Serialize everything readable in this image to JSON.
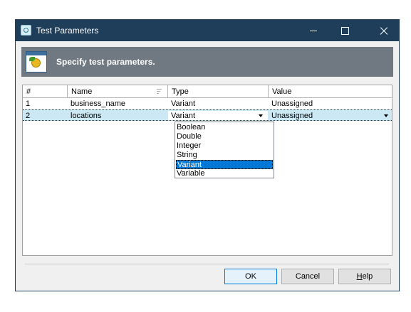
{
  "window": {
    "title": "Test Parameters",
    "icon": "app-icon"
  },
  "header": {
    "text": "Specify test parameters.",
    "icon": "parameters-icon"
  },
  "grid": {
    "columns": [
      "#",
      "Name",
      "Type",
      "Value"
    ],
    "rows": [
      {
        "num": "1",
        "name": "business_name",
        "type": "Variant",
        "value": "Unassigned"
      },
      {
        "num": "2",
        "name": "locations",
        "type": "Variant",
        "value": "Unassigned"
      }
    ],
    "type_options": [
      "Boolean",
      "Double",
      "Integer",
      "String",
      "Variant",
      "Variable"
    ],
    "selected_option": "Variant"
  },
  "buttons": {
    "ok": "OK",
    "cancel": "Cancel",
    "help_mnemonic": "H",
    "help_rest": "elp"
  },
  "colors": {
    "titlebar": "#1f3e5a",
    "header": "#707882",
    "selection": "#cce8f4",
    "highlight": "#0078d7"
  }
}
